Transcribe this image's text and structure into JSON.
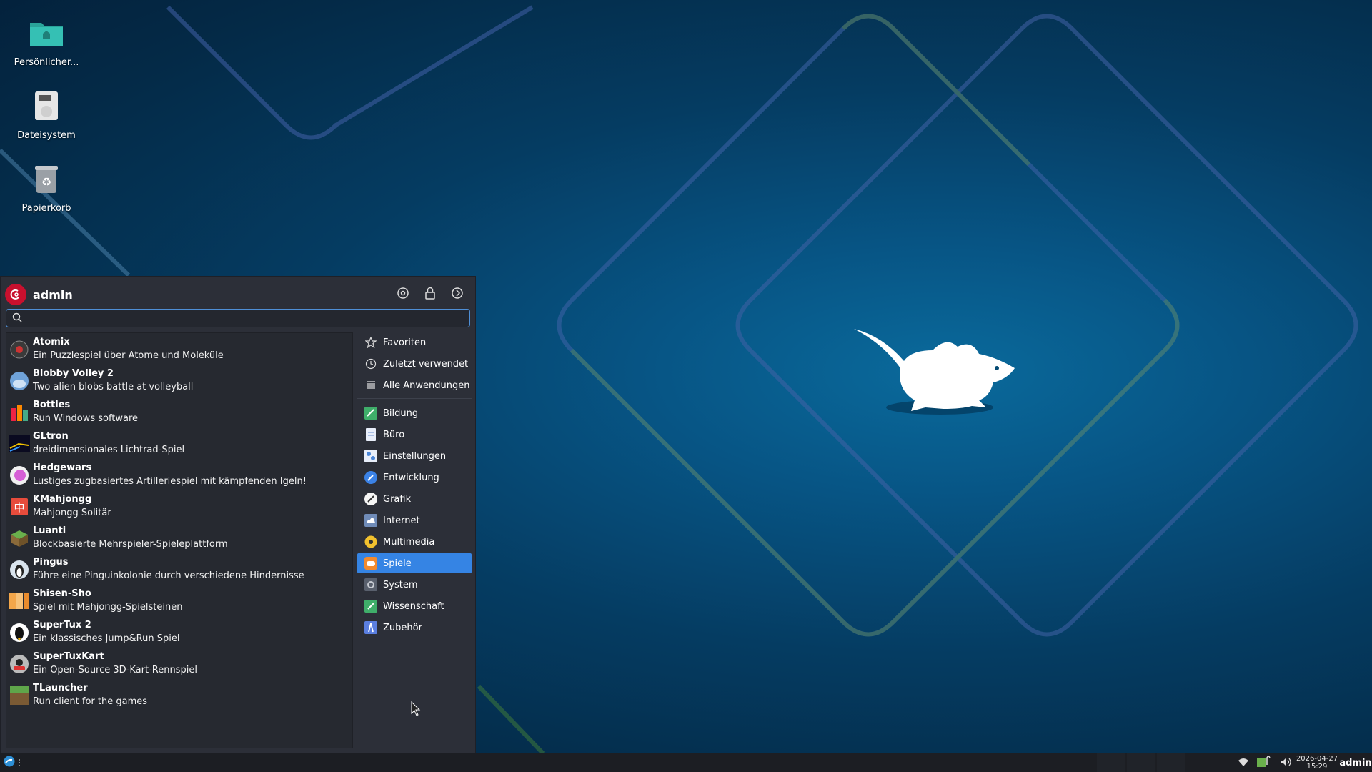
{
  "desktop": {
    "icons": [
      {
        "label": "Persönlicher...",
        "icon": "home-folder-icon"
      },
      {
        "label": "Dateisystem",
        "icon": "filesystem-icon"
      },
      {
        "label": "Papierkorb",
        "icon": "trash-icon"
      }
    ],
    "wallpaper": {
      "name": "xfce-mouse",
      "colors": {
        "bg": "#054a73",
        "line_blue": "#3b5fa0",
        "line_green": "#4f8a6a"
      }
    }
  },
  "menu": {
    "username": "admin",
    "search": {
      "value": "",
      "placeholder": ""
    },
    "header_buttons": [
      "settings-icon",
      "lock-icon",
      "logout-icon"
    ],
    "apps": [
      {
        "name": "Atomix",
        "desc": "Ein Puzzlespiel über Atome und Moleküle",
        "icon": "atomix-icon"
      },
      {
        "name": "Blobby Volley 2",
        "desc": "Two alien blobs battle at volleyball",
        "icon": "blobby-volley-icon"
      },
      {
        "name": "Bottles",
        "desc": "Run Windows software",
        "icon": "bottles-icon"
      },
      {
        "name": "GLtron",
        "desc": "dreidimensionales Lichtrad-Spiel",
        "icon": "gltron-icon"
      },
      {
        "name": "Hedgewars",
        "desc": "Lustiges zugbasiertes Artilleriespiel mit kämpfenden Igeln!",
        "icon": "hedgewars-icon"
      },
      {
        "name": "KMahjongg",
        "desc": "Mahjongg Solitär",
        "icon": "kmahjongg-icon"
      },
      {
        "name": "Luanti",
        "desc": "Blockbasierte Mehrspieler-Spieleplattform",
        "icon": "luanti-icon"
      },
      {
        "name": "Pingus",
        "desc": "Führe eine Pinguinkolonie durch verschiedene Hindernisse",
        "icon": "pingus-icon"
      },
      {
        "name": "Shisen-Sho",
        "desc": "Spiel mit Mahjongg-Spielsteinen",
        "icon": "shisen-sho-icon"
      },
      {
        "name": "SuperTux 2",
        "desc": "Ein klassisches Jump&Run Spiel",
        "icon": "supertux-icon"
      },
      {
        "name": "SuperTuxKart",
        "desc": "Ein Open-Source 3D-Kart-Rennspiel",
        "icon": "supertuxkart-icon"
      },
      {
        "name": "TLauncher",
        "desc": "Run client for the games",
        "icon": "tlauncher-icon"
      }
    ],
    "categories_top": [
      {
        "label": "Favoriten",
        "icon": "star-icon"
      },
      {
        "label": "Zuletzt verwendet",
        "icon": "clock-icon"
      },
      {
        "label": "Alle Anwendungen",
        "icon": "list-icon"
      }
    ],
    "categories": [
      {
        "label": "Bildung",
        "icon": "education-icon"
      },
      {
        "label": "Büro",
        "icon": "office-icon"
      },
      {
        "label": "Einstellungen",
        "icon": "settings-category-icon"
      },
      {
        "label": "Entwicklung",
        "icon": "development-icon"
      },
      {
        "label": "Grafik",
        "icon": "graphics-icon"
      },
      {
        "label": "Internet",
        "icon": "internet-icon"
      },
      {
        "label": "Multimedia",
        "icon": "multimedia-icon"
      },
      {
        "label": "Spiele",
        "icon": "games-icon",
        "active": true
      },
      {
        "label": "System",
        "icon": "system-icon"
      },
      {
        "label": "Wissenschaft",
        "icon": "science-icon"
      },
      {
        "label": "Zubehör",
        "icon": "accessories-icon"
      }
    ],
    "accent_color": "#3584e4"
  },
  "taskbar": {
    "clock_date": "2026-04-27",
    "clock_time": "15:29",
    "user": "admin",
    "tray_icons": [
      "wifi-icon",
      "battery-icon",
      "volume-icon"
    ]
  }
}
